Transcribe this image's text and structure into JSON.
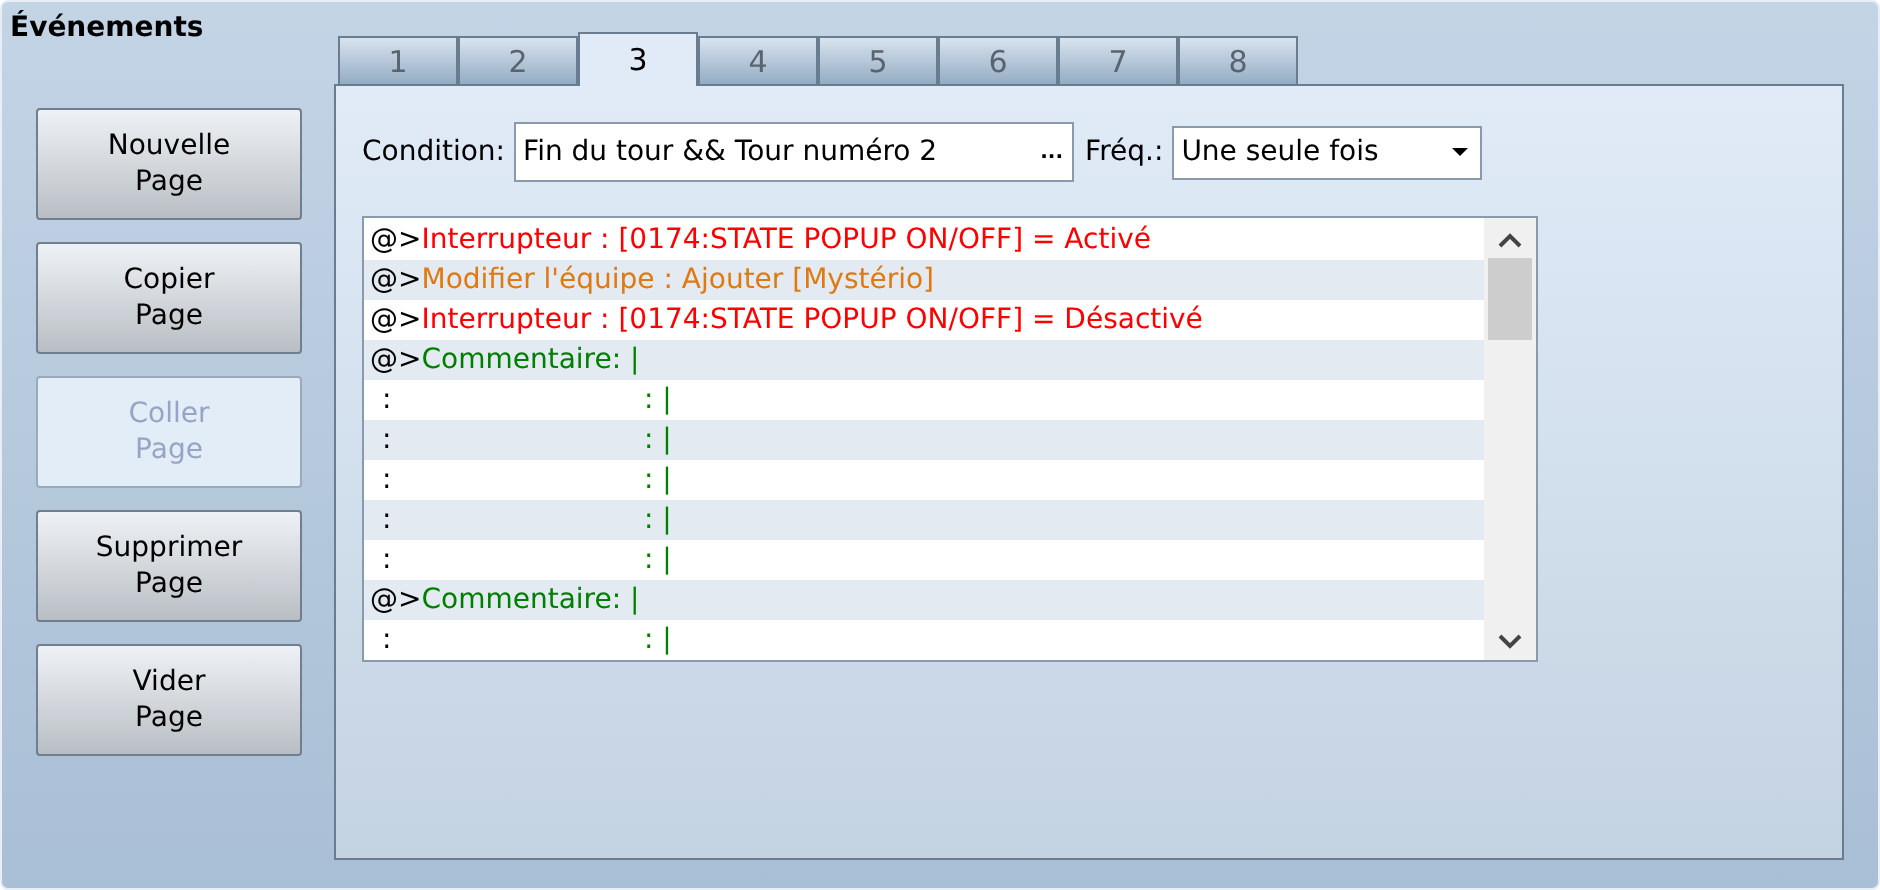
{
  "window": {
    "title": "Événements"
  },
  "buttons": [
    {
      "label": "Nouvelle\nPage",
      "disabled": false
    },
    {
      "label": "Copier\nPage",
      "disabled": false
    },
    {
      "label": "Coller\nPage",
      "disabled": true
    },
    {
      "label": "Supprimer\nPage",
      "disabled": false
    },
    {
      "label": "Vider\nPage",
      "disabled": false
    }
  ],
  "tabs": [
    {
      "label": "1",
      "selected": false
    },
    {
      "label": "2",
      "selected": false
    },
    {
      "label": "3",
      "selected": true
    },
    {
      "label": "4",
      "selected": false
    },
    {
      "label": "5",
      "selected": false
    },
    {
      "label": "6",
      "selected": false
    },
    {
      "label": "7",
      "selected": false
    },
    {
      "label": "8",
      "selected": false
    }
  ],
  "condition": {
    "label": "Condition:",
    "value": "Fin du tour && Tour numéro 2",
    "button": "..."
  },
  "frequency": {
    "label": "Fréq.:",
    "value": "Une seule fois"
  },
  "commands": [
    {
      "kind": "command",
      "prefix": "@>",
      "text": "Interrupteur : [0174:STATE POPUP ON/OFF] = Activé",
      "color": "#ff0000"
    },
    {
      "kind": "command",
      "prefix": "@>",
      "text": "Modifier l'équipe : Ajouter [Mystério]",
      "color": "#e07a10"
    },
    {
      "kind": "command",
      "prefix": "@>",
      "text": "Interrupteur : [0174:STATE POPUP ON/OFF] = Désactivé",
      "color": "#ff0000"
    },
    {
      "kind": "command",
      "prefix": "@>",
      "text": "Commentaire: |",
      "color": "#008000"
    },
    {
      "kind": "continuation",
      "prefix": ":",
      "text": ": |",
      "color": "#008000"
    },
    {
      "kind": "continuation",
      "prefix": ":",
      "text": ": |",
      "color": "#008000"
    },
    {
      "kind": "continuation",
      "prefix": ":",
      "text": ": |",
      "color": "#008000"
    },
    {
      "kind": "continuation",
      "prefix": ":",
      "text": ": |",
      "color": "#008000"
    },
    {
      "kind": "continuation",
      "prefix": ":",
      "text": ": |",
      "color": "#008000"
    },
    {
      "kind": "command",
      "prefix": "@>",
      "text": "Commentaire: |",
      "color": "#008000"
    },
    {
      "kind": "continuation",
      "prefix": ":",
      "text": ": |",
      "color": "#008000"
    }
  ]
}
